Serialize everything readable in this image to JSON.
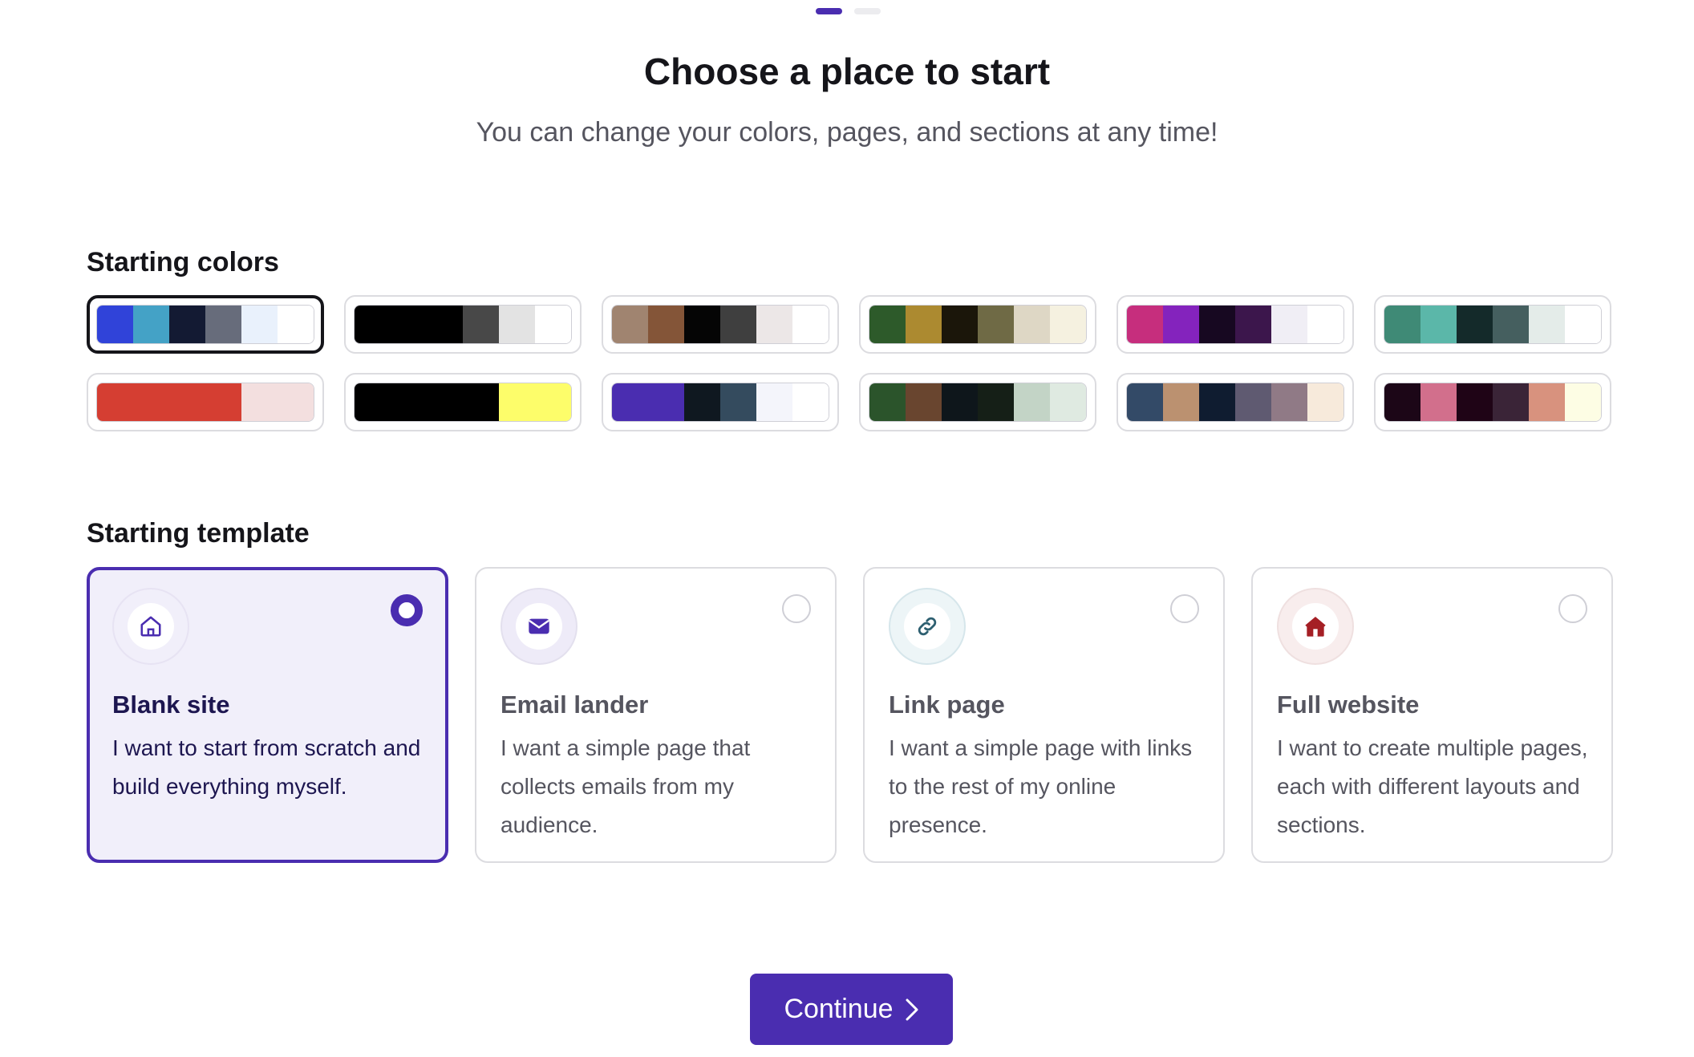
{
  "stepper": {
    "total": 2,
    "current": 1
  },
  "header": {
    "title": "Choose a place to start",
    "subtitle": "You can change your colors, pages, and sections at any time!"
  },
  "colors": {
    "label": "Starting colors",
    "selected_index": 0,
    "palettes": [
      [
        "#3043d9",
        "#44a2c6",
        "#131a33",
        "#676c7b",
        "#e9f1fc",
        "#ffffff"
      ],
      [
        "#000000",
        "#000000",
        "#000000",
        "#484848",
        "#e3e3e3",
        "#ffffff"
      ],
      [
        "#a08470",
        "#845538",
        "#050505",
        "#3f3f3f",
        "#ece7e7",
        "#ffffff"
      ],
      [
        "#2d5a2a",
        "#ac8a30",
        "#1b160a",
        "#6f6a45",
        "#ded7c5",
        "#f5f1e0"
      ],
      [
        "#c62e7d",
        "#8423bd",
        "#170821",
        "#3c164c",
        "#f0eef5",
        "#ffffff"
      ],
      [
        "#3f8a76",
        "#5bb7a9",
        "#142a2a",
        "#455f5f",
        "#e4ece9",
        "#ffffff"
      ],
      [
        "#d53e32",
        "#d53e32",
        "#d53e32",
        "#d53e32",
        "#f3dfdf",
        "#f3dfdf"
      ],
      [
        "#000000",
        "#000000",
        "#000000",
        "#000000",
        "#fdfd6a",
        "#fdfd6a"
      ],
      [
        "#4a2db0",
        "#4a2db0",
        "#0f1820",
        "#344b5e",
        "#f4f5fb",
        "#ffffff"
      ],
      [
        "#2b542b",
        "#69452f",
        "#0e161b",
        "#151f17",
        "#c3d4c6",
        "#dfeae1"
      ],
      [
        "#334a67",
        "#bb9170",
        "#0f1c30",
        "#5f5a71",
        "#907a86",
        "#f7eadb"
      ],
      [
        "#1c0617",
        "#d26f8c",
        "#1f0416",
        "#3a2437",
        "#d8927e",
        "#fdfde4"
      ]
    ]
  },
  "templates": {
    "label": "Starting template",
    "selected_index": 0,
    "items": [
      {
        "title": "Blank site",
        "description": "I want to start from scratch and build everything myself.",
        "icon": "home-outline-icon",
        "ring_color": "#e7e3f3",
        "icon_color": "#4a2db0",
        "ring_bg": "#f1effa"
      },
      {
        "title": "Email lander",
        "description": "I want a simple page that collects emails from my audience.",
        "icon": "envelope-icon",
        "ring_color": "#e3e0ee",
        "icon_color": "#4a2db0",
        "ring_bg": "#eeebf8"
      },
      {
        "title": "Link page",
        "description": "I want a simple page with links to the rest of my online presence.",
        "icon": "link-icon",
        "ring_color": "#d6e6eb",
        "icon_color": "#2d5f70",
        "ring_bg": "#edf5f7"
      },
      {
        "title": "Full website",
        "description": "I want to create multiple pages, each with different layouts and sections.",
        "icon": "home-filled-icon",
        "ring_color": "#efe0e0",
        "icon_color": "#a51f25",
        "ring_bg": "#f8eded"
      }
    ]
  },
  "actions": {
    "continue_label": "Continue",
    "continue_icon": "chevron-right-icon"
  }
}
